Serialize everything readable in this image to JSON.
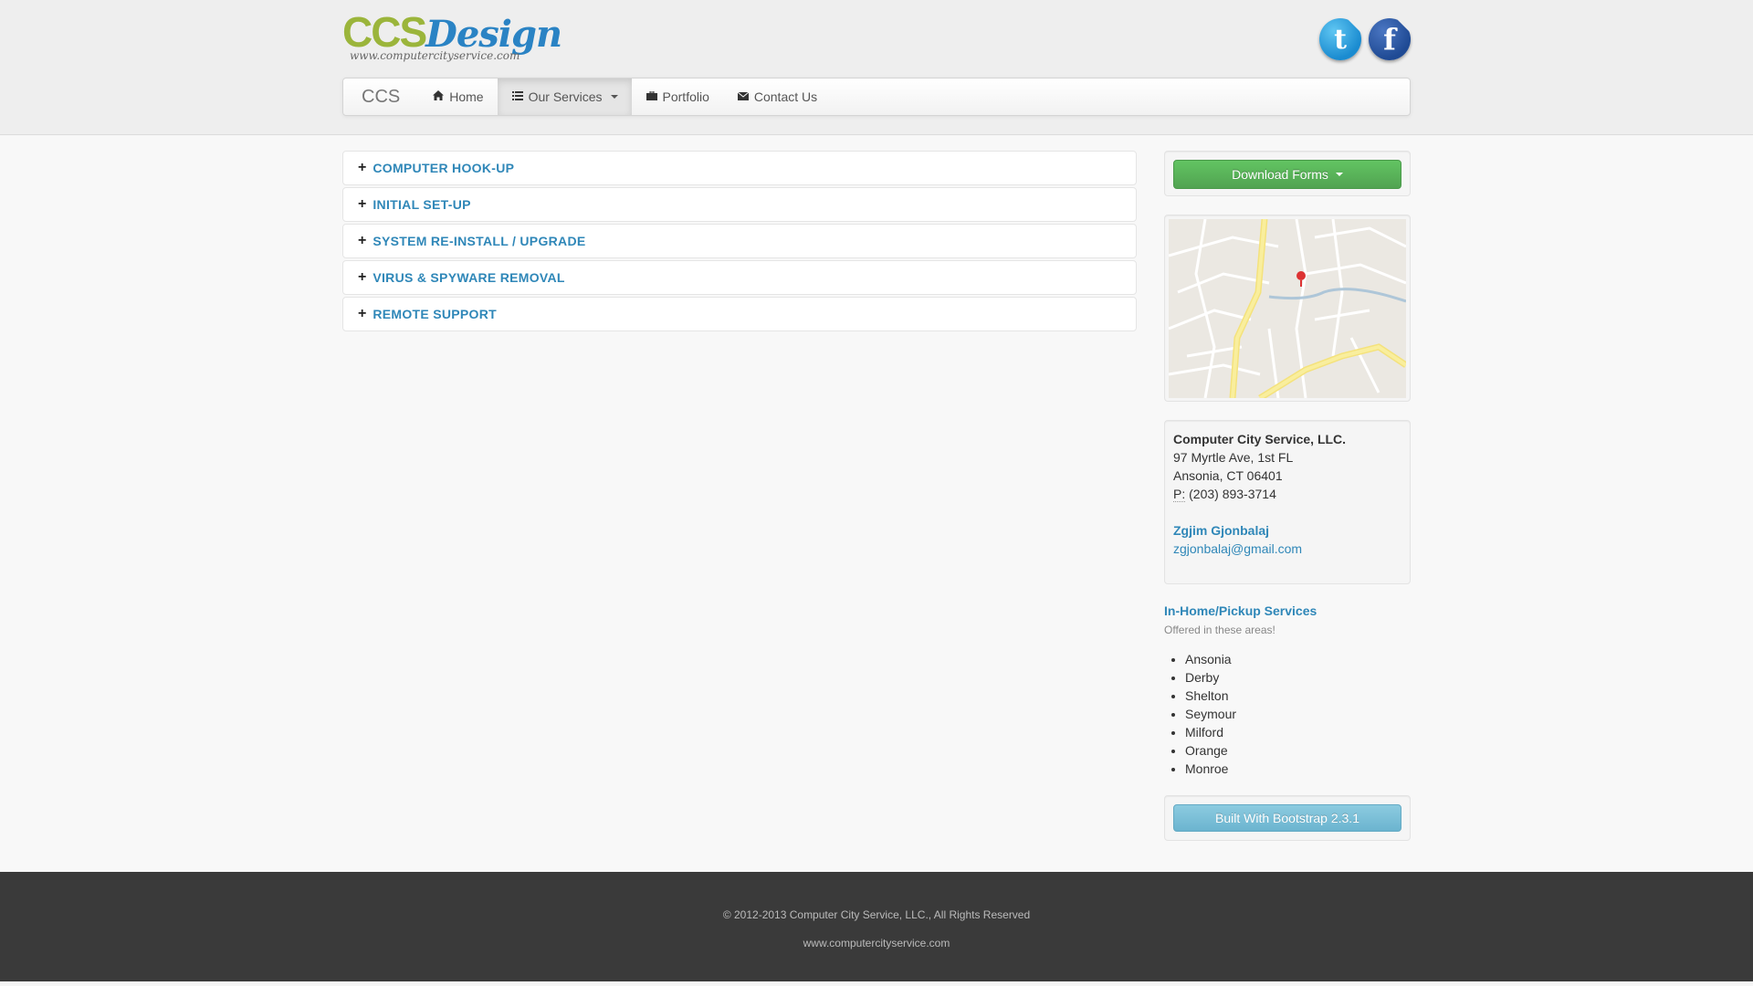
{
  "logo": {
    "ccs": "CCS",
    "design": "Design",
    "url": "www.computercityservice.com"
  },
  "social": {
    "twitter_glyph": "t",
    "facebook_glyph": "f"
  },
  "navbar": {
    "brand": "CCS",
    "items": [
      {
        "label": "Home",
        "icon": "home-icon"
      },
      {
        "label": "Our Services",
        "icon": "list-icon"
      },
      {
        "label": "Portfolio",
        "icon": "briefcase-icon"
      },
      {
        "label": "Contact Us",
        "icon": "envelope-icon"
      }
    ]
  },
  "accordion": {
    "items": [
      "COMPUTER HOOK-UP",
      "INITIAL SET-UP",
      "SYSTEM RE-INSTALL / UPGRADE",
      "VIRUS & SPYWARE REMOVAL",
      "REMOTE SUPPORT"
    ],
    "plus_glyph": "+"
  },
  "sidebar": {
    "download_label": "Download Forms",
    "contact": {
      "company": "Computer City Service, LLC.",
      "address1": "97 Myrtle Ave, 1st FL",
      "address2": "Ansonia, CT 06401",
      "phone_abbr": "P:",
      "phone": "(203) 893-3714",
      "person": "Zgjim Gjonbalaj",
      "email": "zgjonbalaj@gmail.com"
    },
    "areas": {
      "title": "In-Home/Pickup Services",
      "subtitle": "Offered in these areas!",
      "list": [
        "Ansonia",
        "Derby",
        "Shelton",
        "Seymour",
        "Milford",
        "Orange",
        "Monroe"
      ]
    },
    "bootstrap_label": "Built With Bootstrap 2.3.1"
  },
  "footer": {
    "copyright": "© 2012-2013 Computer City Service, LLC., All Rights Reserved",
    "url": "www.computercityservice.com"
  },
  "colors": {
    "link": "#2f87b8",
    "company": "#2e8b3b",
    "success": "#5bb75b",
    "info": "#7bbfd8",
    "footer_bg": "#3a3a3a"
  }
}
